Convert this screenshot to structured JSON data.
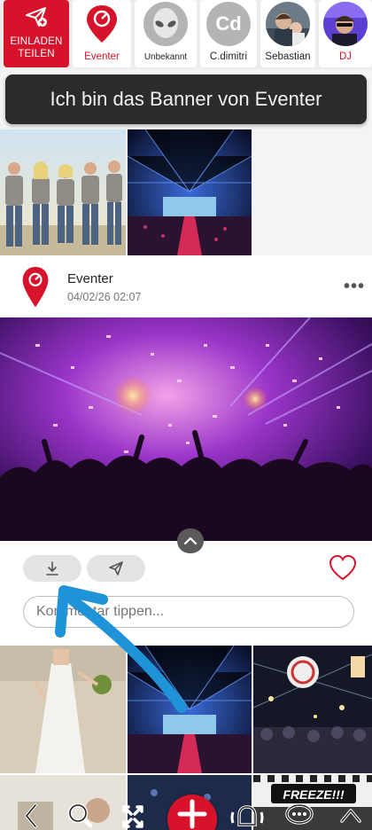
{
  "invite": {
    "label": "EINLADEN\nTEILEN"
  },
  "people": [
    {
      "name": "Eventer",
      "avatar": "map-pin-logo",
      "active": true
    },
    {
      "name": "Unbekannt",
      "avatar": "alien-icon"
    },
    {
      "name": "C.dimitri",
      "avatar_text": "Cd"
    },
    {
      "name": "Sebastian",
      "avatar": "photo"
    },
    {
      "name": "DJ",
      "avatar": "photo"
    }
  ],
  "banner": {
    "text": "Ich bin das Banner von Eventer"
  },
  "post": {
    "author": "Eventer",
    "date": "04/02/26 02:07",
    "comment_placeholder": "Kommentar tippen..."
  },
  "gallery_overlay": {
    "freeze_text": "FREEZE!!!"
  },
  "colors": {
    "brand_red": "#d6132a",
    "annotation_blue": "#1f93d8"
  },
  "icons": [
    "send-icon",
    "download-icon",
    "share-icon",
    "heart-icon",
    "chevron-up-icon",
    "back-icon",
    "search-icon",
    "expand-icon",
    "plus-icon",
    "bell-icon",
    "chat-icon"
  ]
}
